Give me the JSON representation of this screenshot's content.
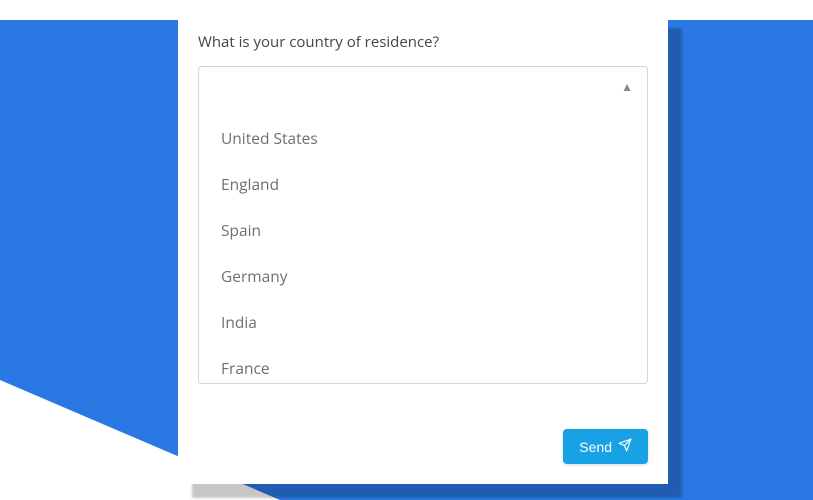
{
  "form": {
    "question": "What is your country of residence?",
    "selected": "",
    "options": [
      "United States",
      "England",
      "Spain",
      "Germany",
      "India",
      "France"
    ]
  },
  "buttons": {
    "send": "Send"
  }
}
